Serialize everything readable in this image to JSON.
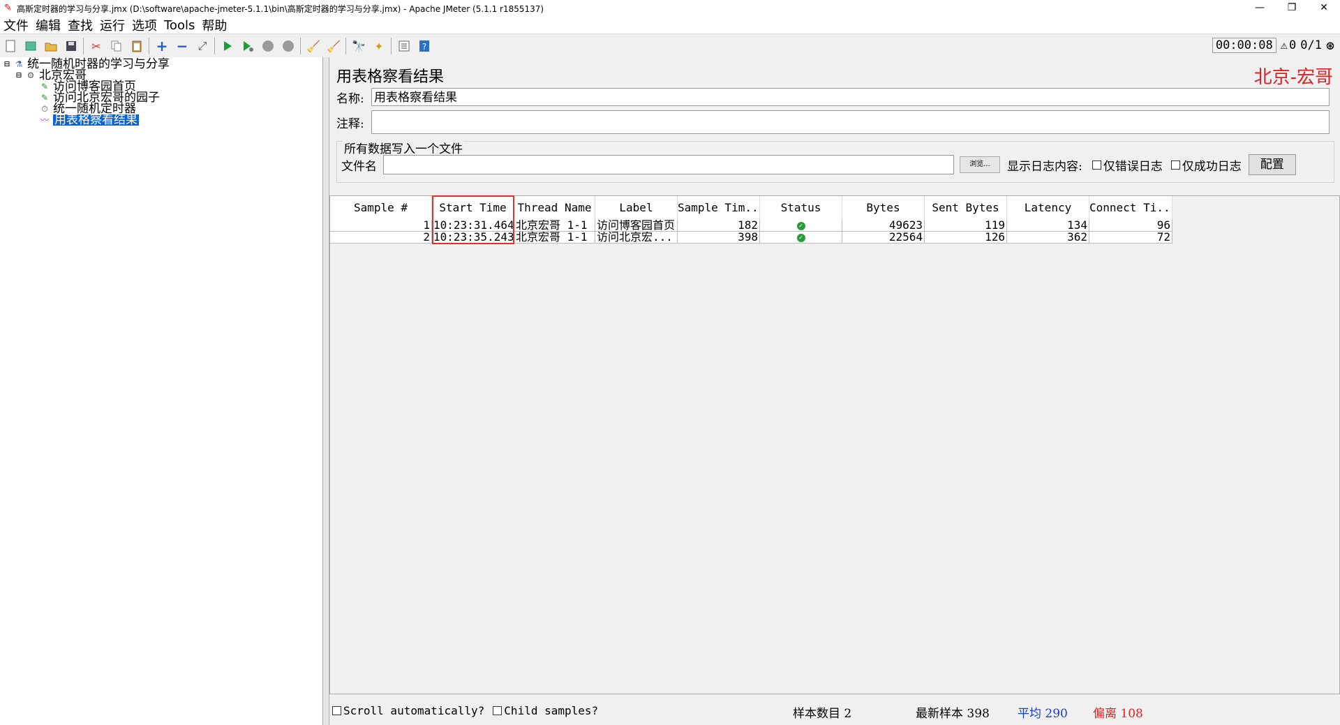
{
  "window": {
    "title": "高斯定时器的学习与分享.jmx (D:\\software\\apache-jmeter-5.1.1\\bin\\高斯定时器的学习与分享.jmx) - Apache JMeter (5.1.1 r1855137)",
    "controls": [
      "—",
      "❐",
      "✕"
    ]
  },
  "menu": [
    "文件",
    "编辑",
    "查找",
    "运行",
    "选项",
    "Tools",
    "帮助"
  ],
  "toolbar": {
    "timer": "00:00:08",
    "warning_count": "0",
    "threads": "0/1"
  },
  "tree": [
    {
      "label": "统一随机时器的学习与分享",
      "icon": "flask-icon",
      "expander": "⊟",
      "level": 0
    },
    {
      "label": "北京宏哥",
      "icon": "gear-icon",
      "expander": "⊟",
      "level": 1
    },
    {
      "label": "访问博客园首页",
      "icon": "pen-icon",
      "expander": "",
      "level": 2
    },
    {
      "label": "访问北京宏哥的园子",
      "icon": "pen-icon",
      "expander": "",
      "level": 2
    },
    {
      "label": "统一随机定时器",
      "icon": "clock-icon",
      "expander": "",
      "level": 2
    },
    {
      "label": "用表格察看结果",
      "icon": "chart-icon",
      "expander": "",
      "level": 2,
      "selected": true
    }
  ],
  "panel": {
    "title": "用表格察看结果",
    "brand": "北京-宏哥",
    "name_label": "名称:",
    "name_value": "用表格察看结果",
    "comment_label": "注释:",
    "comment_value": "",
    "fileset_legend": "所有数据写入一个文件",
    "filename_label": "文件名",
    "filename_value": "",
    "browse_label": "浏览...",
    "log_label": "显示日志内容:",
    "errors_only": "仅错误日志",
    "success_only": "仅成功日志",
    "config_button": "配置"
  },
  "table": {
    "columns": [
      "Sample #",
      "Start Time",
      "Thread Name",
      "Label",
      "Sample Tim...",
      "Status",
      "Bytes",
      "Sent Bytes",
      "Latency",
      "Connect Ti..."
    ],
    "rows": [
      [
        "1",
        "10:23:31.464",
        "北京宏哥 1-1",
        "访问博客园首页",
        "182",
        "ok",
        "49623",
        "119",
        "134",
        "96"
      ],
      [
        "2",
        "10:23:35.243",
        "北京宏哥 1-1",
        "访问北京宏...",
        "398",
        "ok",
        "22564",
        "126",
        "362",
        "72"
      ]
    ]
  },
  "footer": {
    "scroll_auto": "Scroll automatically?",
    "child_samples": "Child samples?",
    "sample_count": "样本数目 2",
    "latest_sample": "最新样本 398",
    "average": "平均 290",
    "deviation": "偏离 108"
  },
  "colors": {
    "brand": "#e02020",
    "average": "#1a3cc8",
    "deviation": "#e02020",
    "selection": "#0a64d6",
    "highlight_box": "#e0302c"
  }
}
